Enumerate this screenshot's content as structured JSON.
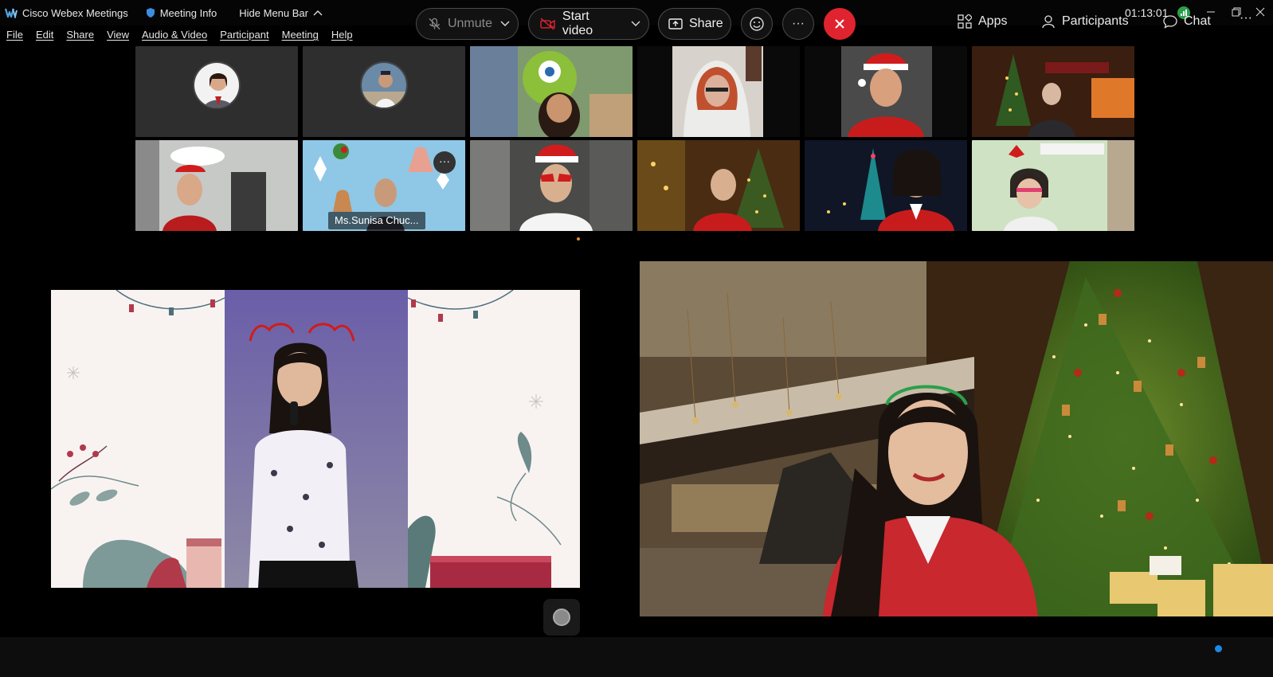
{
  "titlebar": {
    "app_name": "Cisco Webex Meetings",
    "meeting_info": "Meeting Info",
    "hide_menu": "Hide Menu Bar",
    "clock": "01:13:01",
    "icons": [
      "webex-logo-icon",
      "shield-icon",
      "chevron-up-icon",
      "signal-icon",
      "minimize-icon",
      "restore-icon",
      "close-icon"
    ]
  },
  "menu": {
    "items": [
      "File",
      "Edit",
      "Share",
      "View",
      "Audio & Video",
      "Participant",
      "Meeting",
      "Help"
    ]
  },
  "participants": {
    "thumbnails": [
      {
        "type": "avatar",
        "bg": "#2e2e2e"
      },
      {
        "type": "avatar",
        "bg": "#2e2e2e"
      },
      {
        "type": "video",
        "bg": "#3f6a4a"
      },
      {
        "type": "video",
        "bg": "#d8d3cf"
      },
      {
        "type": "video",
        "bg": "#0e0e0e"
      },
      {
        "type": "video",
        "bg": "#4a2a1a"
      },
      {
        "type": "video",
        "bg": "#cfd4d6"
      },
      {
        "type": "video",
        "bg": "#8ec8e8",
        "name": "Ms.Sunisa Chuc..."
      },
      {
        "type": "video",
        "bg": "#3a3a3a"
      },
      {
        "type": "video",
        "bg": "#5a3a18"
      },
      {
        "type": "video",
        "bg": "#141a2e"
      },
      {
        "type": "video",
        "bg": "#c4e0b8"
      }
    ],
    "more_label": "···"
  },
  "controls": {
    "unmute": "Unmute",
    "start_video": "Start video",
    "share": "Share",
    "more": "···",
    "apps": "Apps",
    "participants": "Participants",
    "chat": "Chat",
    "overflow": "···"
  },
  "colors": {
    "leave_red": "#e0242f",
    "chat_badge": "#1e88e5",
    "signal_green": "#2aa04a"
  }
}
